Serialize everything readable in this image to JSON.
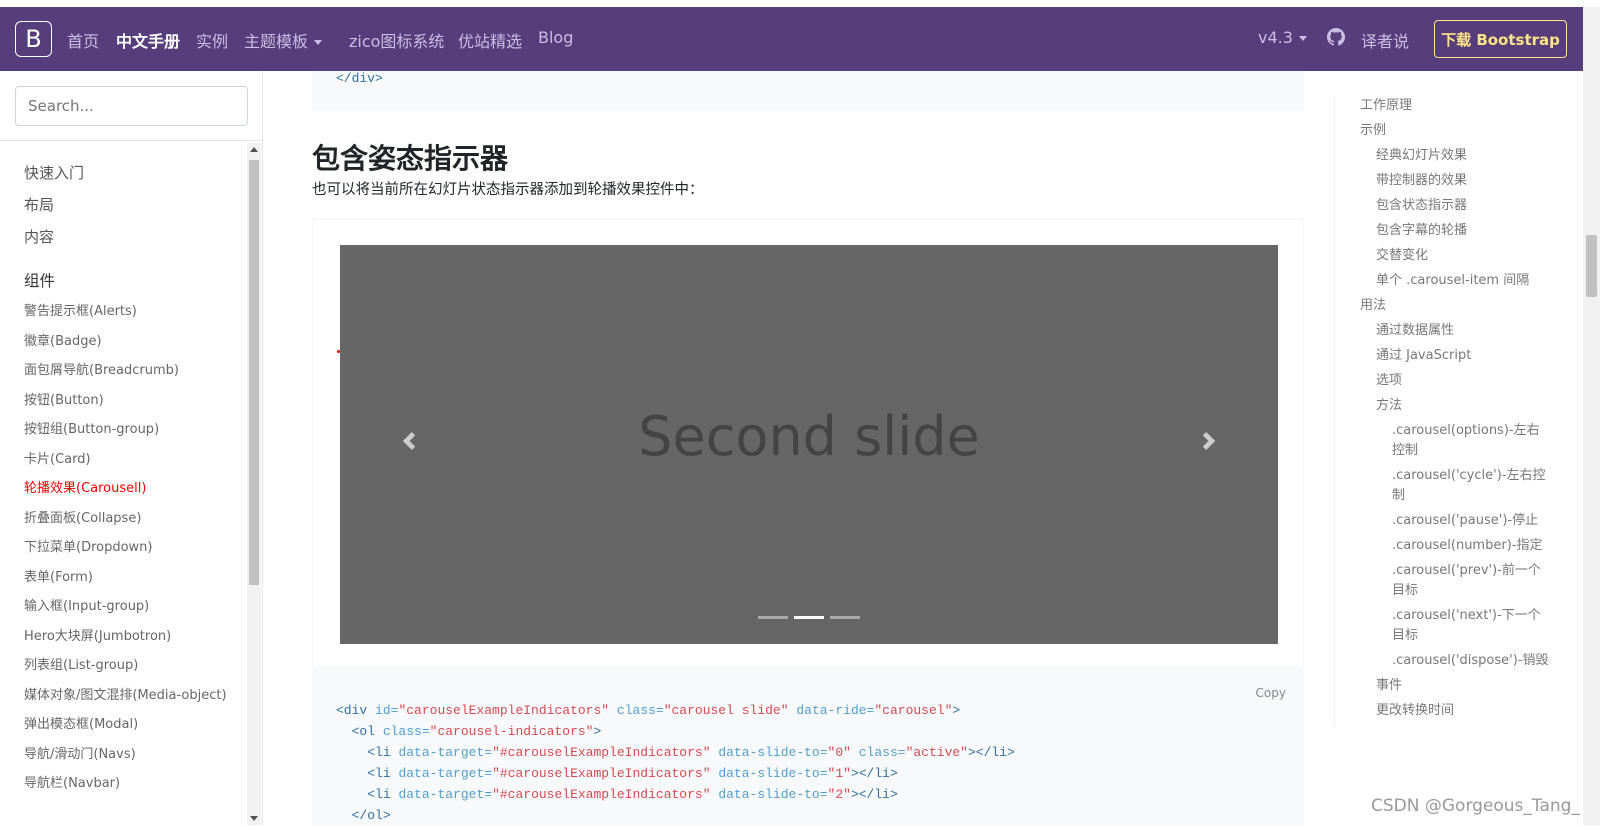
{
  "navbar": {
    "brand": "B",
    "links": [
      "首页",
      "中文手册",
      "实例",
      "主题模板",
      "zico图标系统",
      "优站精选",
      "Blog"
    ],
    "version": "v4.3",
    "translator": "译者说",
    "download": "下载 Bootstrap"
  },
  "sidebar": {
    "search_placeholder": "Search...",
    "groups": [
      "快速入门",
      "布局",
      "内容"
    ],
    "components_head": "组件",
    "items": [
      "警告提示框(Alerts)",
      "徽章(Badge)",
      "面包屑导航(Breadcrumb)",
      "按钮(Button)",
      "按钮组(Button-group)",
      "卡片(Card)",
      "轮播效果(Carousell)",
      "折叠面板(Collapse)",
      "下拉菜单(Dropdown)",
      "表单(Form)",
      "输入框(Input-group)",
      "Hero大块屏(Jumbotron)",
      "列表组(List-group)",
      "媒体对象/图文混排(Media-object)",
      "弹出模态框(Modal)",
      "导航/滑动门(Navs)",
      "导航栏(Navbar)"
    ],
    "active_index": 6
  },
  "main": {
    "code_top_line": "</div>",
    "section_title": "包含姿态指示器",
    "section_desc": "也可以将当前所在幻灯片状态指示器添加到轮播效果控件中：",
    "slide_label": "Second slide",
    "carousel_active_indicator": 1,
    "copy_label": "Copy"
  },
  "toc": {
    "items": [
      {
        "label": "工作原理",
        "level": 1
      },
      {
        "label": "示例",
        "level": 1
      },
      {
        "label": "经典幻灯片效果",
        "level": 2
      },
      {
        "label": "带控制器的效果",
        "level": 2
      },
      {
        "label": "包含状态指示器",
        "level": 2
      },
      {
        "label": "包含字幕的轮播",
        "level": 2
      },
      {
        "label": "交替变化",
        "level": 2
      },
      {
        "label": "单个 .carousel-item 间隔",
        "level": 2
      },
      {
        "label": "用法",
        "level": 1
      },
      {
        "label": "通过数据属性",
        "level": 2
      },
      {
        "label": "通过 JavaScript",
        "level": 2
      },
      {
        "label": "选项",
        "level": 2
      },
      {
        "label": "方法",
        "level": 2
      },
      {
        "label": ".carousel(options)-左右控制",
        "level": 3
      },
      {
        "label": ".carousel('cycle')-左右控制",
        "level": 3
      },
      {
        "label": ".carousel('pause')-停止",
        "level": 3
      },
      {
        "label": ".carousel(number)-指定",
        "level": 3
      },
      {
        "label": ".carousel('prev')-前一个目标",
        "level": 3
      },
      {
        "label": ".carousel('next')-下一个目标",
        "level": 3
      },
      {
        "label": ".carousel('dispose')-销毁",
        "level": 3
      },
      {
        "label": "事件",
        "level": 2
      },
      {
        "label": "更改转换时间",
        "level": 2
      }
    ]
  },
  "watermark": "CSDN @Gorgeous_Tang_",
  "colors": {
    "navbar": "#563d7c",
    "accent": "#ffe484",
    "active_link": "#ee0000"
  }
}
